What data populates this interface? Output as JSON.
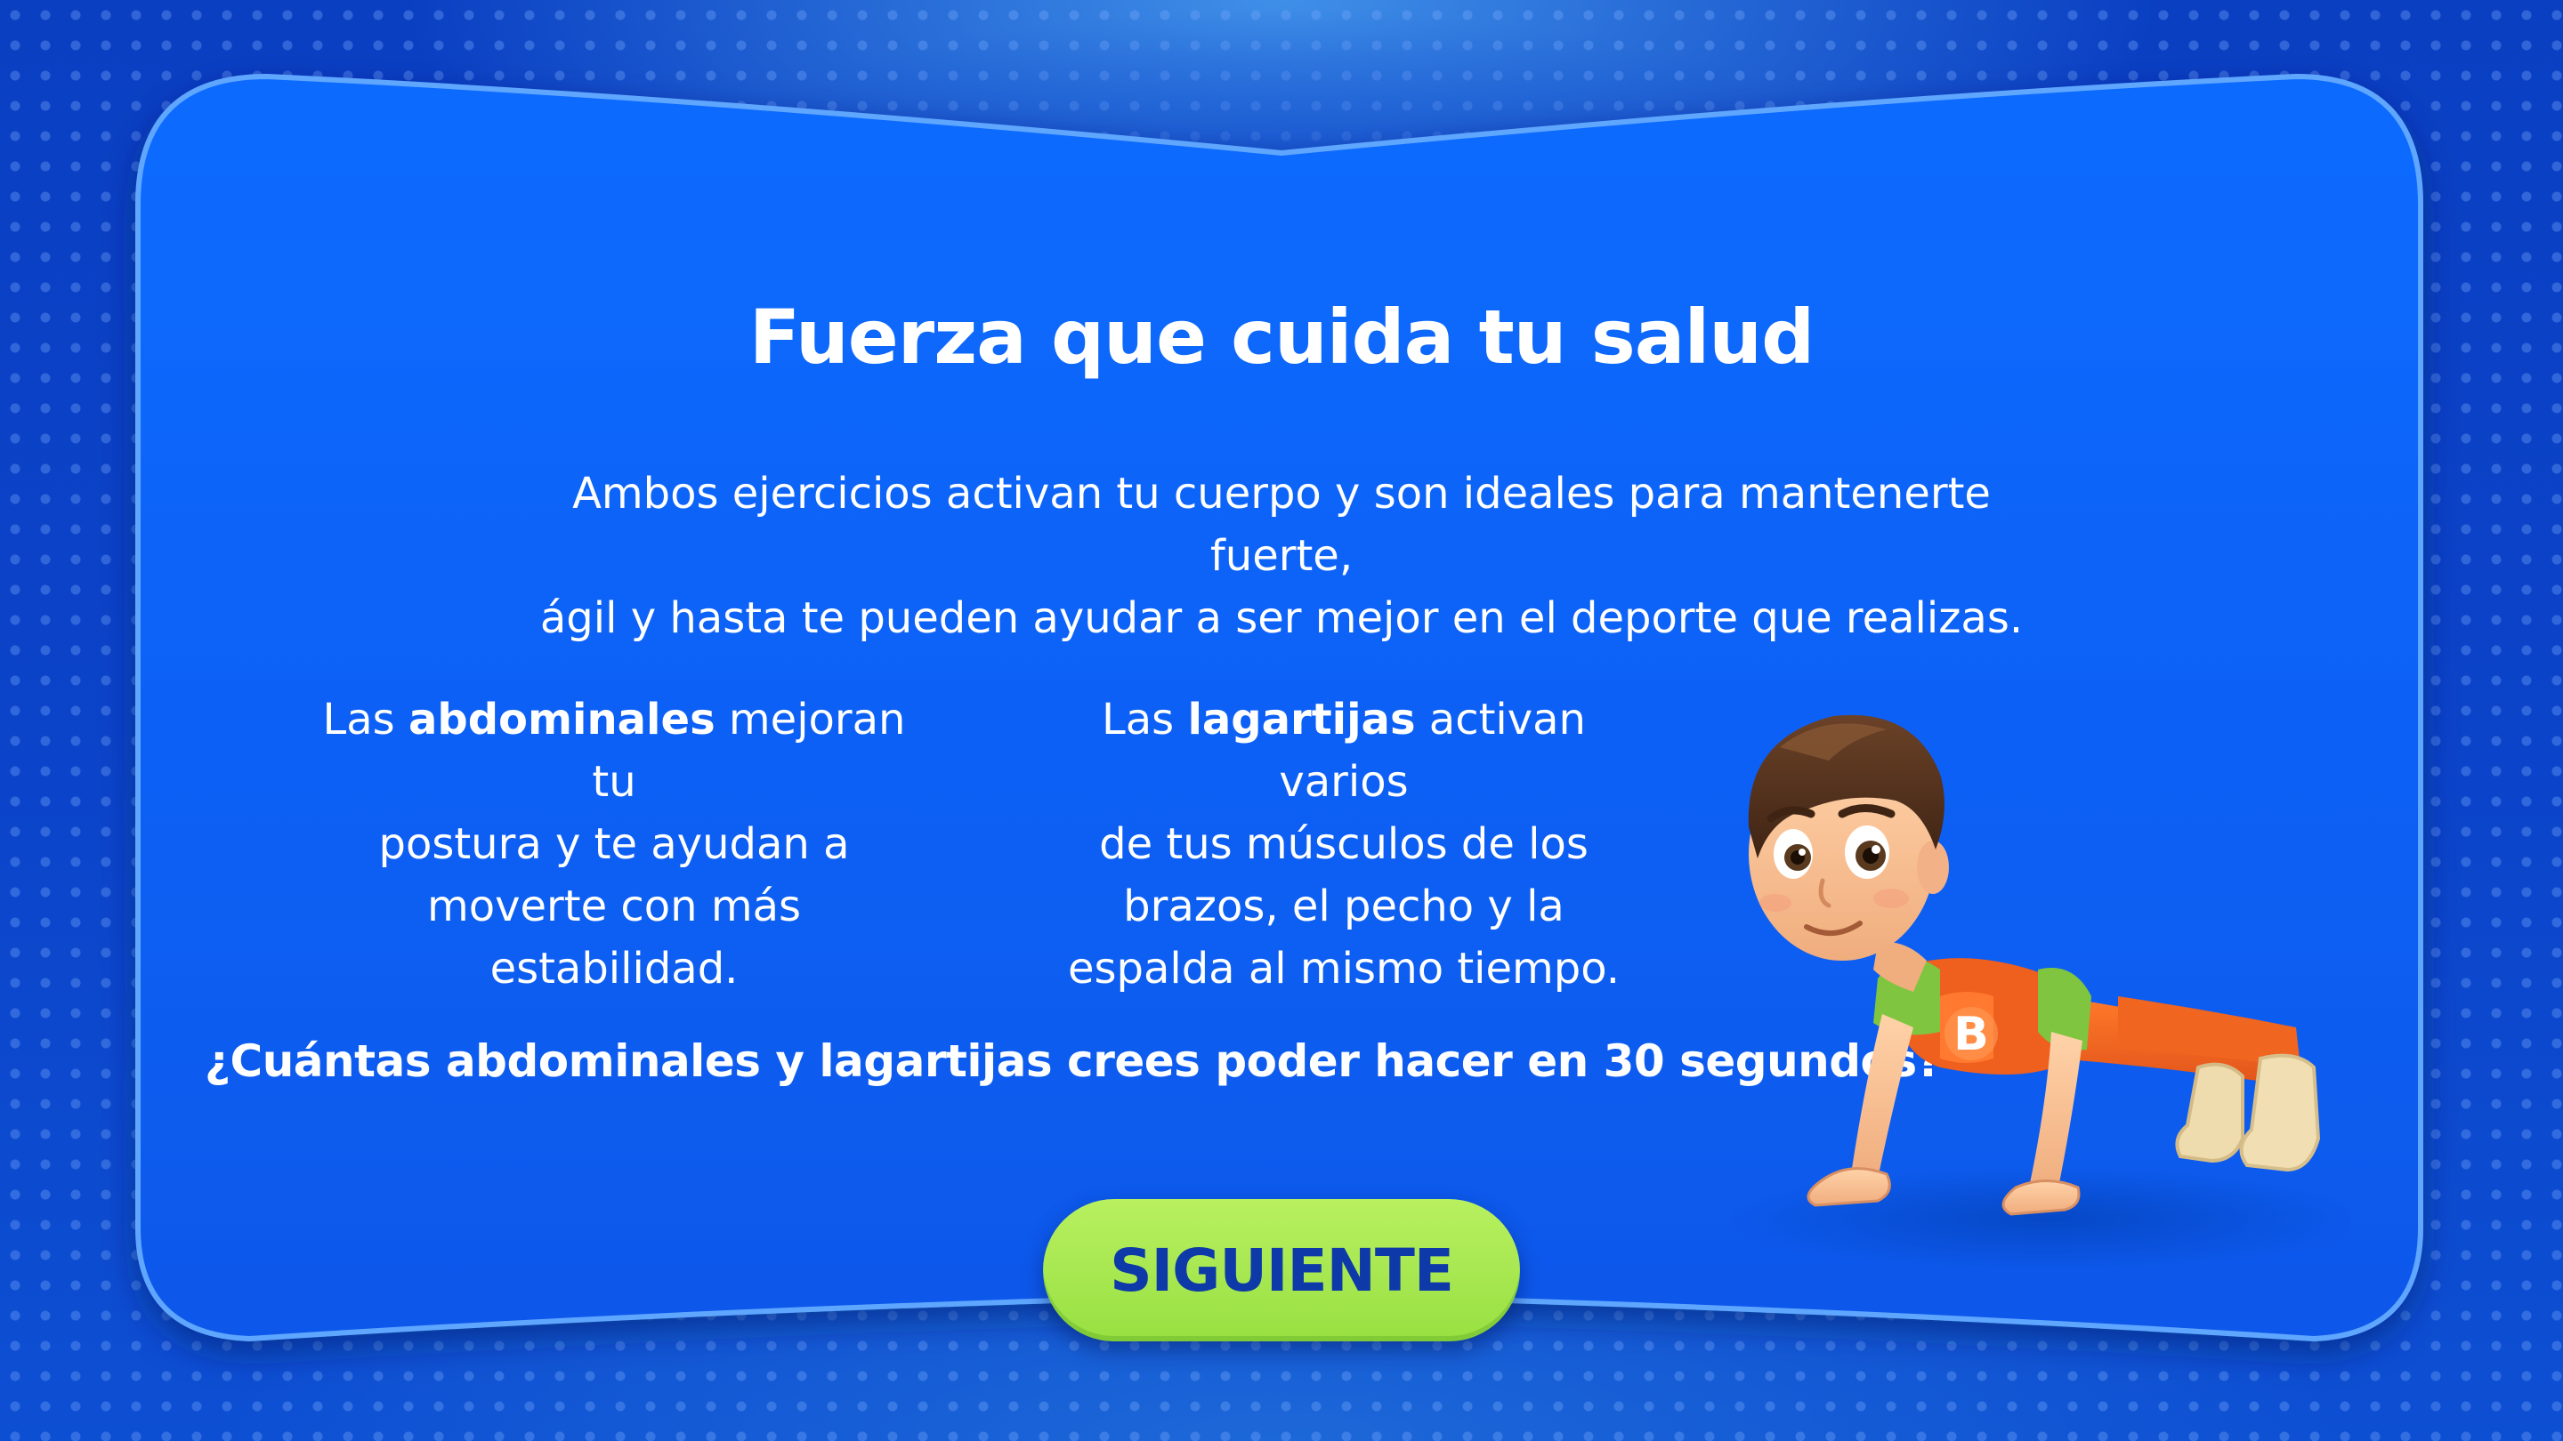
{
  "card": {
    "title": "Fuerza que cuida tu salud",
    "intro_line1": "Ambos ejercicios activan tu cuerpo y son ideales para mantenerte fuerte,",
    "intro_line2": "ágil y hasta te pueden ayudar a ser mejor en el deporte que realizas."
  },
  "left_column": {
    "prefix": "Las ",
    "keyword": "abdominales",
    "rest_line1": " mejoran tu",
    "line2": "postura y te ayudan a",
    "line3": "moverte con más",
    "line4": "estabilidad."
  },
  "right_column": {
    "prefix": "Las ",
    "keyword": "lagartijas",
    "rest_line1": " activan varios",
    "line2": "de tus músculos de los",
    "line3": "brazos, el pecho y la",
    "line4": "espalda al mismo tiempo."
  },
  "question": "¿Cuántas abdominales y lagartijas crees poder hacer en 30 segundos?",
  "next_button": {
    "label": "SIGUIENTE"
  },
  "character": {
    "shirt_letter": "B",
    "icon": "pushup-boy-illustration"
  },
  "colors": {
    "background": "#0b43c9",
    "panel": "#0a66ff",
    "panel_border": "#5aa2ff",
    "button": "#a6e84e",
    "button_text": "#0d3aa8",
    "text": "#ffffff"
  }
}
